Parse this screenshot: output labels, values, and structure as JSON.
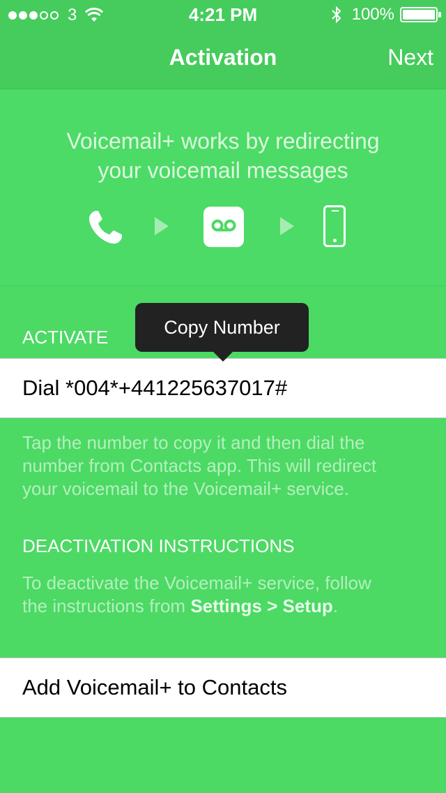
{
  "status_bar": {
    "carrier": "3",
    "time": "4:21 PM",
    "battery_percent": "100%",
    "signal_bars_filled": 3,
    "signal_bars_total": 5
  },
  "nav": {
    "title": "Activation",
    "next_label": "Next"
  },
  "hero": {
    "line1": "Voicemail+ works by redirecting",
    "line2": "your voicemail messages",
    "icons": [
      "phone-handset-icon",
      "play-arrow-icon",
      "voicemail-icon",
      "play-arrow-icon",
      "iphone-icon"
    ]
  },
  "activate": {
    "header": "ACTIVATE",
    "tooltip": "Copy Number",
    "row_label": "Dial *004*+441225637017#",
    "footnote_line1": "Tap the number to copy it and then dial the",
    "footnote_line2": "number from Contacts app. This will redirect",
    "footnote_line3": "your voicemail to the Voicemail+ service."
  },
  "deactivation": {
    "header": "DEACTIVATION INSTRUCTIONS",
    "line1": "To deactivate the Voicemail+ service, follow",
    "line2_prefix": "the instructions from ",
    "line2_bold": "Settings > Setup",
    "line2_suffix": "."
  },
  "contacts_row": {
    "label": "Add Voicemail+ to Contacts"
  },
  "colors": {
    "background": "#4cd964",
    "nav_bar": "#45cc5c",
    "tooltip": "#222222"
  }
}
